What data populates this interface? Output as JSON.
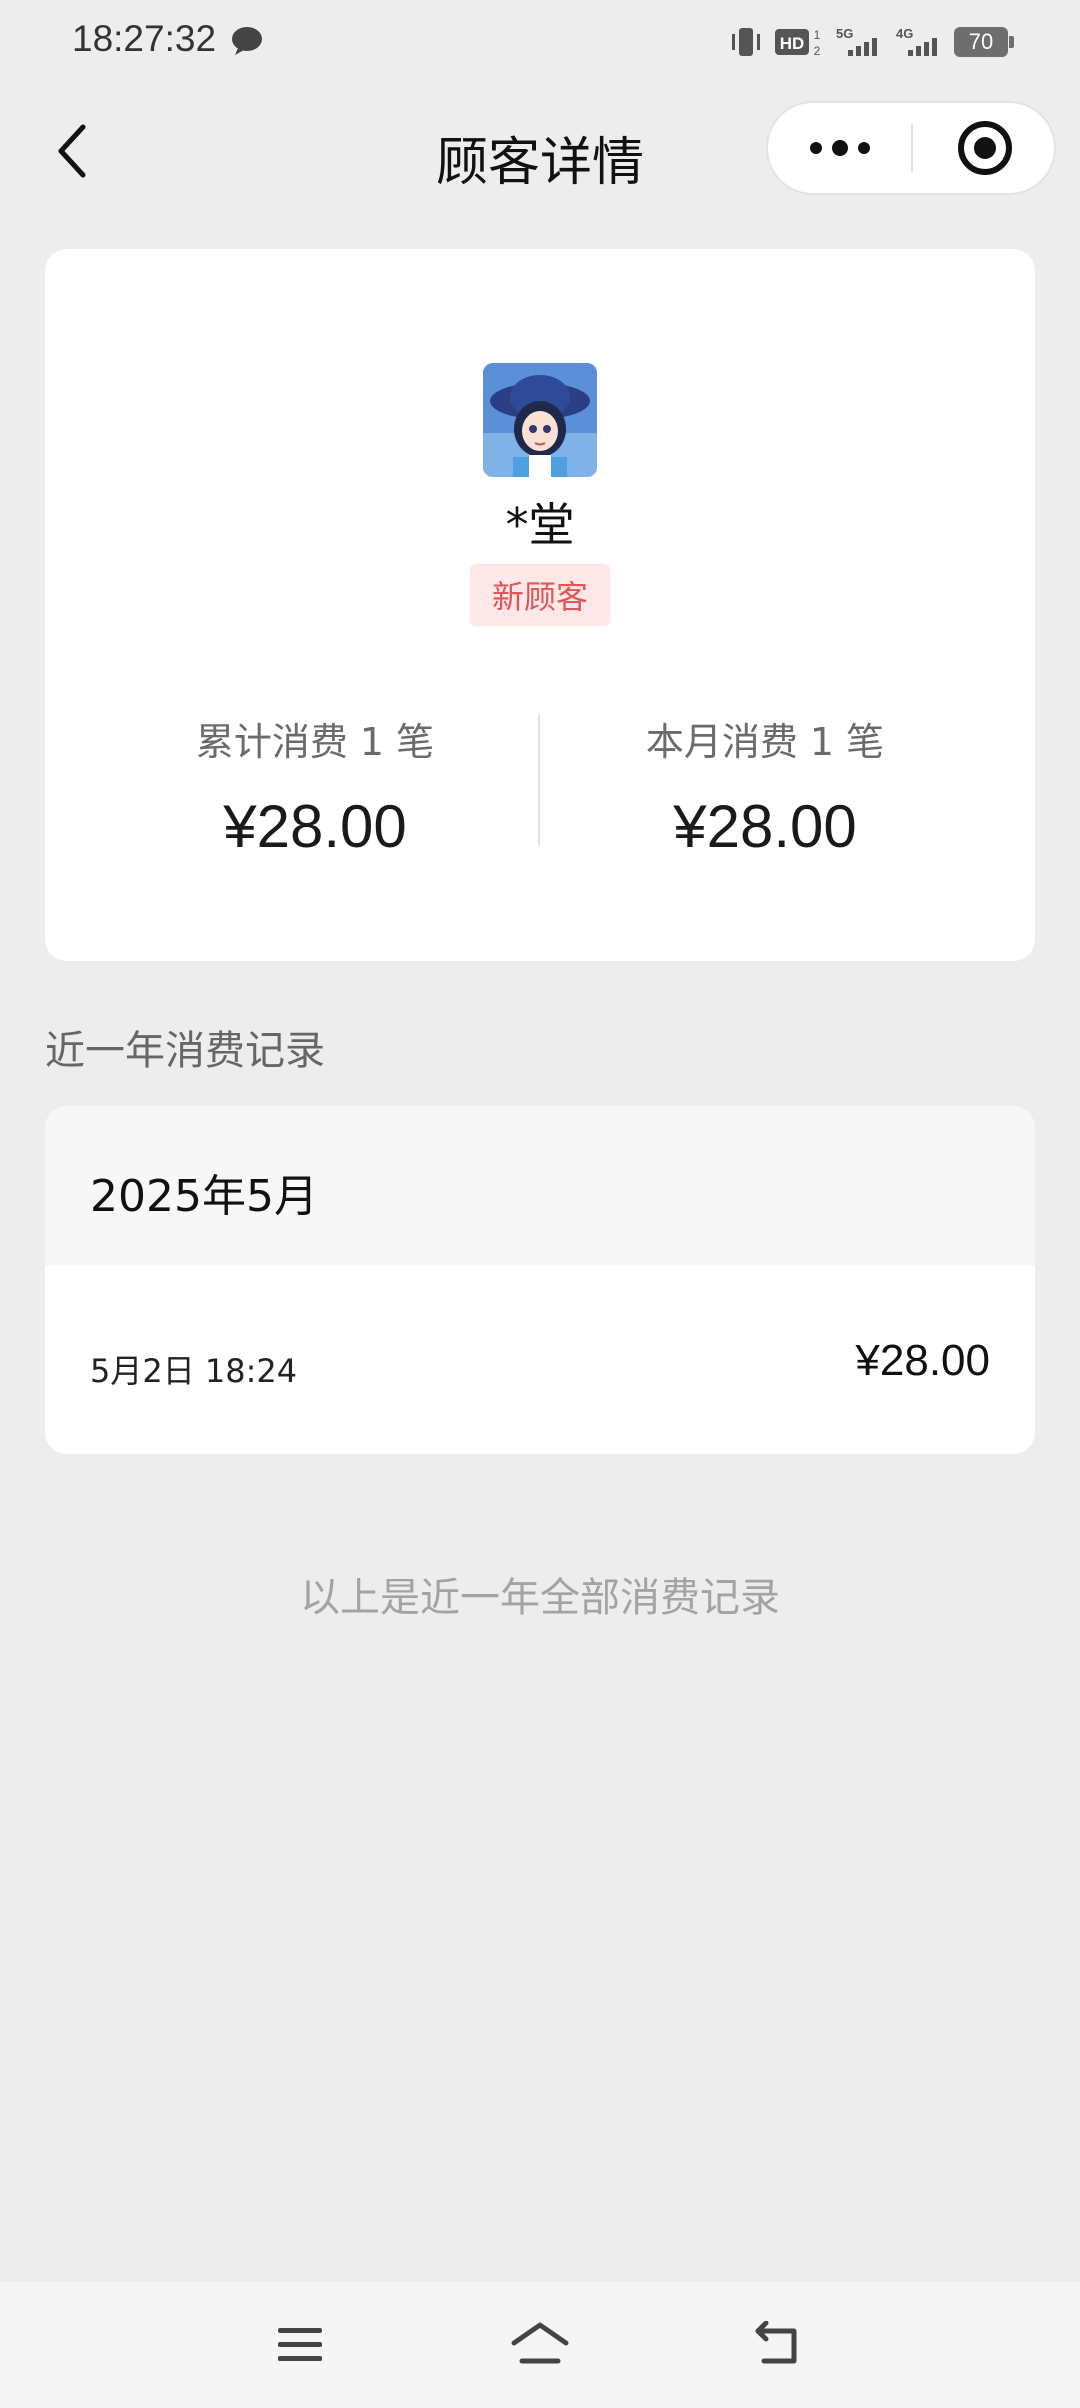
{
  "status_bar": {
    "time": "18:27:32",
    "battery": "70",
    "icons": [
      "message-icon",
      "vibrate-icon",
      "hd-icon",
      "5g-signal-icon",
      "4g-signal-icon",
      "battery-icon"
    ]
  },
  "nav": {
    "title": "顾客详情",
    "icons": [
      "back-icon",
      "more-icon",
      "close-target-icon"
    ]
  },
  "customer": {
    "name": "*堂",
    "tag": "新顾客"
  },
  "stats": {
    "total_label": "累计消费 1 笔",
    "total_value": "¥28.00",
    "month_label": "本月消费 1 笔",
    "month_value": "¥28.00"
  },
  "records": {
    "section_title": "近一年消费记录",
    "month": "2025年5月",
    "items": [
      {
        "time": "5月2日 18:24",
        "amount": "¥28.00"
      }
    ],
    "footer": "以上是近一年全部消费记录"
  },
  "system_nav": {
    "icons": [
      "menu-icon",
      "home-icon",
      "back-icon"
    ]
  },
  "colors": {
    "background": "#ededed",
    "card": "#ffffff",
    "tag_bg": "#fde7e7",
    "tag_text": "#e0575b"
  }
}
